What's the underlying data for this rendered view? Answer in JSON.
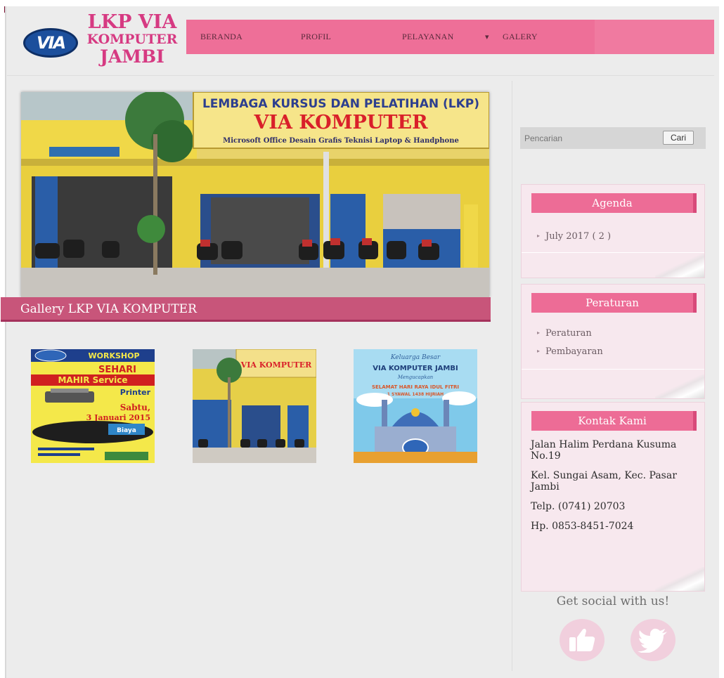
{
  "site": {
    "logo_mark": "VIA",
    "logo_line1": "LKP VIA",
    "logo_line2": "KOMPUTER",
    "logo_line3": "JAMBI"
  },
  "nav": {
    "items": [
      "BERANDA",
      "PROFIL",
      "PELAYANAN",
      "GALERY"
    ],
    "dropdown_indicator": "▾"
  },
  "banner": {
    "sign_line1": "LEMBAGA KURSUS DAN PELATIHAN (LKP)",
    "sign_line2": "VIA KOMPUTER",
    "sign_line3": "Microsoft Office   Desain Grafis   Teknisi Laptop & Handphone"
  },
  "gallery": {
    "title": "Gallery LKP VIA KOMPUTER",
    "thumbs": [
      {
        "heading": "WORKSHOP",
        "line1": "SEHARI",
        "line2": "MAHIR Service",
        "line3": "Printer",
        "line4": "Sabtu,",
        "line5": "3 Januari 2015",
        "badge": "Biaya"
      },
      {
        "sign": "VIA KOMPUTER"
      },
      {
        "line1": "Keluarga Besar",
        "line2": "VIA KOMPUTER JAMBI",
        "line3": "Mengucapkan",
        "line4": "SELAMAT HARI RAYA IDUL FITRI",
        "line5": "1 SYAWAL 1438 HIJRIAH"
      }
    ]
  },
  "sidebar": {
    "search_placeholder": "Pencarian",
    "search_button": "Cari",
    "agenda_title": "Agenda",
    "agenda_items": [
      "July 2017 ( 2 )"
    ],
    "peraturan_title": "Peraturan",
    "peraturan_items": [
      "Peraturan",
      "Pembayaran"
    ],
    "kontak_title": "Kontak Kami",
    "kontak": {
      "address1": "Jalan Halim Perdana Kusuma No.19",
      "address2": "Kel. Sungai Asam, Kec. Pasar Jambi",
      "telp": "Telp.  (0741) 20703",
      "hp": "Hp.  0853-8451-7024"
    },
    "social_title": "Get social with us!"
  },
  "colors": {
    "accent": "#ed6c96",
    "gallery_bar": "#c8557a",
    "logo_pink": "#d63a82",
    "logo_blue": "#1c4f9c"
  }
}
